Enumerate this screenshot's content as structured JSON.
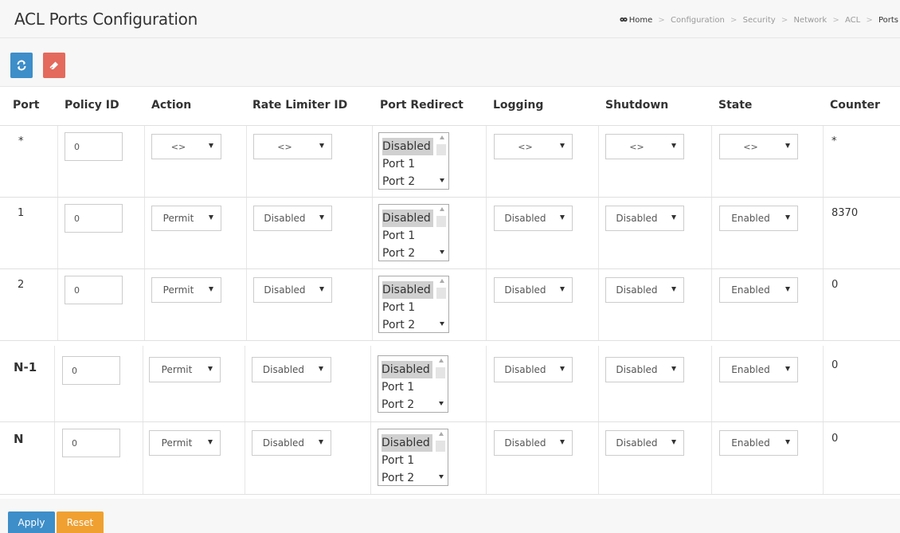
{
  "page": {
    "title": "ACL Ports Configuration",
    "breadcrumb": [
      "Home",
      "Configuration",
      "Security",
      "Network",
      "ACL",
      "Ports"
    ]
  },
  "toolbar": {
    "refresh_icon": "refresh-icon",
    "clear_icon": "eraser-icon",
    "colors": {
      "refresh": "#3d8ec9",
      "clear": "#e36a5d"
    }
  },
  "table": {
    "headers": [
      "Port",
      "Policy ID",
      "Action",
      "Rate Limiter ID",
      "Port Redirect",
      "Logging",
      "Shutdown",
      "State",
      "Counter"
    ],
    "redirect_options": [
      "Disabled",
      "Port 1",
      "Port 2"
    ],
    "rows": [
      {
        "port": "*",
        "policy_id": "0",
        "action": "<>",
        "rate_limiter": "<>",
        "redirect": "Disabled",
        "logging": "<>",
        "shutdown": "<>",
        "state": "<>",
        "counter": "*"
      },
      {
        "port": "1",
        "policy_id": "0",
        "action": "Permit",
        "rate_limiter": "Disabled",
        "redirect": "Disabled",
        "logging": "Disabled",
        "shutdown": "Disabled",
        "state": "Enabled",
        "counter": "8370"
      },
      {
        "port": "2",
        "policy_id": "0",
        "action": "Permit",
        "rate_limiter": "Disabled",
        "redirect": "Disabled",
        "logging": "Disabled",
        "shutdown": "Disabled",
        "state": "Enabled",
        "counter": "0"
      },
      {
        "port": "N-1",
        "policy_id": "0",
        "action": "Permit",
        "rate_limiter": "Disabled",
        "redirect": "Disabled",
        "logging": "Disabled",
        "shutdown": "Disabled",
        "state": "Enabled",
        "counter": "0"
      },
      {
        "port": "N",
        "policy_id": "0",
        "action": "Permit",
        "rate_limiter": "Disabled",
        "redirect": "Disabled",
        "logging": "Disabled",
        "shutdown": "Disabled",
        "state": "Enabled",
        "counter": "0"
      }
    ]
  },
  "footer": {
    "apply_label": "Apply",
    "reset_label": "Reset",
    "colors": {
      "apply": "#3d8ec9",
      "reset": "#f0a030"
    }
  }
}
